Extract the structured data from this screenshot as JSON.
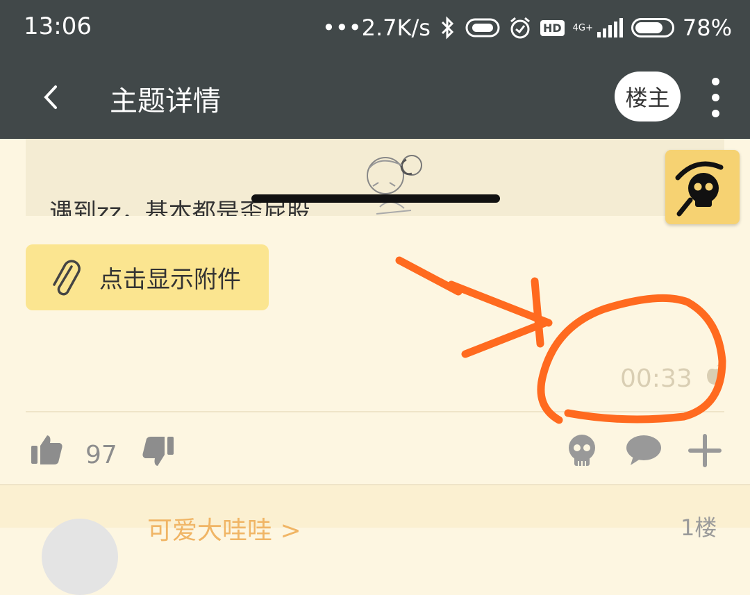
{
  "status_bar": {
    "time": "13:06",
    "network_speed": "•••2.7K/s",
    "hd_badge": "HD",
    "network_type": "4G+",
    "battery_percent": "78%",
    "battery_level": 0.78
  },
  "toolbar": {
    "title": "主题详情",
    "owner_button": "楼主",
    "back_icon": "chevron-left-icon",
    "more_icon": "more-vertical-icon"
  },
  "post": {
    "image_caption": "遇到zz，基本都是歪屁股",
    "attachment_button": "点击显示附件",
    "time": "00:33",
    "likes": "97"
  },
  "reply": {
    "name": "可爱大哇哇 >",
    "floor": "1楼"
  },
  "colors": {
    "toolbar": "#414849",
    "background": "#fdf6e1",
    "attachment": "#fbe590",
    "fab": "#f6d272",
    "annotation": "#ff6a1f",
    "accent_name": "#f0b565"
  }
}
